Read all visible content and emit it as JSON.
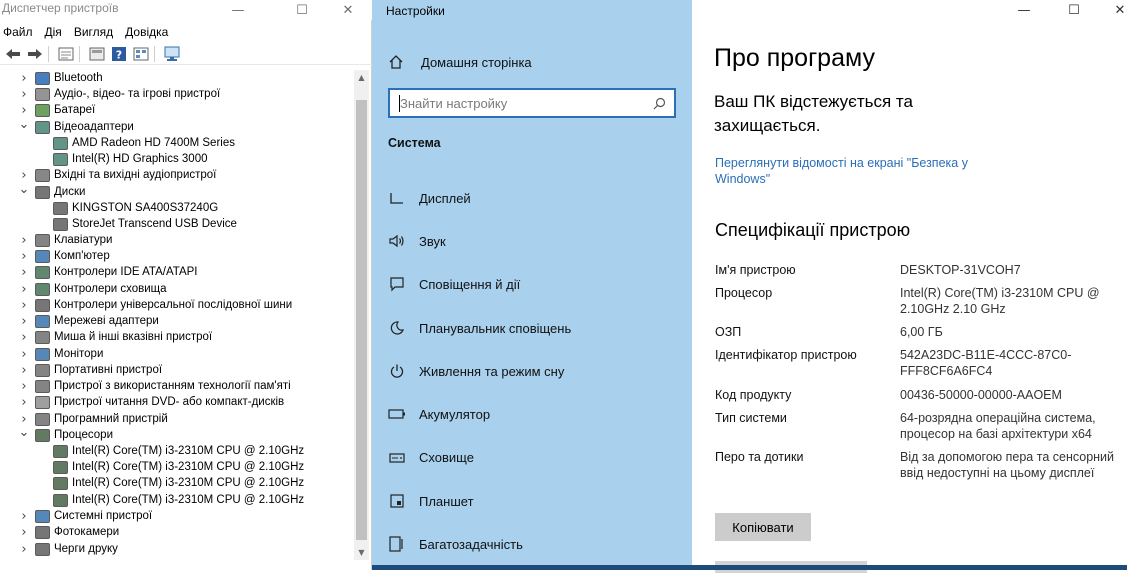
{
  "device_manager": {
    "title": "Диспетчер пристроїв",
    "window_controls": {
      "minimize": "—",
      "maximize": "☐",
      "close": "✕"
    },
    "menu": [
      "Файл",
      "Дія",
      "Вигляд",
      "Довідка"
    ],
    "toolbar_icons": [
      "back-icon",
      "forward-icon",
      "properties-icon",
      "update-icon",
      "help-icon",
      "view-icon",
      "scan-icon"
    ],
    "tree": [
      {
        "label": "Bluetooth",
        "level": 0,
        "expanded": false,
        "icon": "bluetooth-icon",
        "color": "#1a5fb4"
      },
      {
        "label": "Аудіо-, відео- та ігрові пристрої",
        "level": 0,
        "expanded": false,
        "icon": "audio-icon",
        "color": "#7a7a7a"
      },
      {
        "label": "Батареї",
        "level": 0,
        "expanded": false,
        "icon": "battery-icon",
        "color": "#4a8a3a"
      },
      {
        "label": "Відеоадаптери",
        "level": 0,
        "expanded": true,
        "icon": "display-adapter-icon",
        "color": "#3c7a6a"
      },
      {
        "label": "AMD Radeon HD 7400M Series",
        "level": 1,
        "expanded": null,
        "icon": "display-adapter-icon",
        "color": "#3c7a6a"
      },
      {
        "label": "Intel(R) HD Graphics 3000",
        "level": 1,
        "expanded": null,
        "icon": "display-adapter-icon",
        "color": "#3c7a6a"
      },
      {
        "label": "Вхідні та вихідні аудіопристрої",
        "level": 0,
        "expanded": false,
        "icon": "speaker-icon",
        "color": "#6a6a6a"
      },
      {
        "label": "Диски",
        "level": 0,
        "expanded": true,
        "icon": "disk-icon",
        "color": "#555555"
      },
      {
        "label": "KINGSTON SA400S37240G",
        "level": 1,
        "expanded": null,
        "icon": "disk-icon",
        "color": "#555555"
      },
      {
        "label": "StoreJet Transcend USB Device",
        "level": 1,
        "expanded": null,
        "icon": "disk-icon",
        "color": "#555555"
      },
      {
        "label": "Клавіатури",
        "level": 0,
        "expanded": false,
        "icon": "keyboard-icon",
        "color": "#666666"
      },
      {
        "label": "Комп'ютер",
        "level": 0,
        "expanded": false,
        "icon": "computer-icon",
        "color": "#2c6aa8"
      },
      {
        "label": "Контролери IDE ATA/ATAPI",
        "level": 0,
        "expanded": false,
        "icon": "controller-icon",
        "color": "#3a6a4a"
      },
      {
        "label": "Контролери сховища",
        "level": 0,
        "expanded": false,
        "icon": "storage-icon",
        "color": "#3a6a4a"
      },
      {
        "label": "Контролери універсальної послідовної шини",
        "level": 0,
        "expanded": false,
        "icon": "usb-icon",
        "color": "#555555"
      },
      {
        "label": "Мережеві адаптери",
        "level": 0,
        "expanded": false,
        "icon": "network-icon",
        "color": "#2c6aa8"
      },
      {
        "label": "Миша й інші вказівні пристрої",
        "level": 0,
        "expanded": false,
        "icon": "mouse-icon",
        "color": "#666666"
      },
      {
        "label": "Монітори",
        "level": 0,
        "expanded": false,
        "icon": "monitor-icon",
        "color": "#2c6aa8"
      },
      {
        "label": "Портативні пристрої",
        "level": 0,
        "expanded": false,
        "icon": "portable-icon",
        "color": "#666666"
      },
      {
        "label": "Пристрої з використанням технології пам'яті",
        "level": 0,
        "expanded": false,
        "icon": "memory-icon",
        "color": "#666666"
      },
      {
        "label": "Пристрої читання DVD- або компакт-дисків",
        "level": 0,
        "expanded": false,
        "icon": "dvd-icon",
        "color": "#888888"
      },
      {
        "label": "Програмний пристрій",
        "level": 0,
        "expanded": false,
        "icon": "software-device-icon",
        "color": "#666666"
      },
      {
        "label": "Процесори",
        "level": 0,
        "expanded": true,
        "icon": "cpu-icon",
        "color": "#3a5a3a"
      },
      {
        "label": "Intel(R) Core(TM) i3-2310M CPU @ 2.10GHz",
        "level": 1,
        "expanded": null,
        "icon": "cpu-icon",
        "color": "#3a5a3a"
      },
      {
        "label": "Intel(R) Core(TM) i3-2310M CPU @ 2.10GHz",
        "level": 1,
        "expanded": null,
        "icon": "cpu-icon",
        "color": "#3a5a3a"
      },
      {
        "label": "Intel(R) Core(TM) i3-2310M CPU @ 2.10GHz",
        "level": 1,
        "expanded": null,
        "icon": "cpu-icon",
        "color": "#3a5a3a"
      },
      {
        "label": "Intel(R) Core(TM) i3-2310M CPU @ 2.10GHz",
        "level": 1,
        "expanded": null,
        "icon": "cpu-icon",
        "color": "#3a5a3a"
      },
      {
        "label": "Системні пристрої",
        "level": 0,
        "expanded": false,
        "icon": "system-icon",
        "color": "#2c6aa8"
      },
      {
        "label": "Фотокамери",
        "level": 0,
        "expanded": false,
        "icon": "camera-icon",
        "color": "#555555"
      },
      {
        "label": "Черги друку",
        "level": 0,
        "expanded": false,
        "icon": "printer-icon",
        "color": "#555555"
      }
    ]
  },
  "settings": {
    "app_title": "Настройки",
    "window_controls": {
      "minimize": "—",
      "maximize": "☐",
      "close": "✕"
    },
    "home_label": "Домашня сторінка",
    "search_placeholder": "Знайти настройку",
    "section_title": "Система",
    "nav": [
      {
        "label": "Дисплей",
        "icon": "display-icon"
      },
      {
        "label": "Звук",
        "icon": "sound-icon"
      },
      {
        "label": "Сповіщення й дії",
        "icon": "notifications-icon"
      },
      {
        "label": "Планувальник сповіщень",
        "icon": "focus-assist-icon"
      },
      {
        "label": "Живлення та режим сну",
        "icon": "power-icon"
      },
      {
        "label": "Акумулятор",
        "icon": "battery-icon"
      },
      {
        "label": "Сховище",
        "icon": "storage-icon"
      },
      {
        "label": "Планшет",
        "icon": "tablet-icon"
      },
      {
        "label": "Багатозадачність",
        "icon": "multitasking-icon"
      }
    ],
    "page_title": "Про програму",
    "protection_text": "Ваш ПК відстежується та захищається.",
    "security_link": "Переглянути відомості на екрані \"Безпека у Windows\"",
    "specs_title": "Специфікації пристрою",
    "specs": [
      {
        "key": "Ім'я пристрою",
        "value": "DESKTOP-31VCOH7"
      },
      {
        "key": "Процесор",
        "value": "Intel(R) Core(TM) i3-2310M CPU @ 2.10GHz   2.10 GHz"
      },
      {
        "key": "ОЗП",
        "value": "6,00 ГБ"
      },
      {
        "key": "Ідентифікатор пристрою",
        "value": "542A23DC-B11E-4CCC-87C0-FFF8CF6A6FC4"
      },
      {
        "key": "Код продукту",
        "value": "00436-50000-00000-AAOEM"
      },
      {
        "key": "Тип системи",
        "value": "64-розрядна операційна система, процесор на базі архітектури x64"
      },
      {
        "key": "Перо та дотики",
        "value": "Від за допомогою пера та сенсорний ввід недоступні на цьому дисплеї"
      }
    ],
    "copy_button": "Копіювати",
    "colors": {
      "nav_bg": "#a9d1ee",
      "accent": "#2a6fb7",
      "button_bg": "#cccccc"
    }
  }
}
